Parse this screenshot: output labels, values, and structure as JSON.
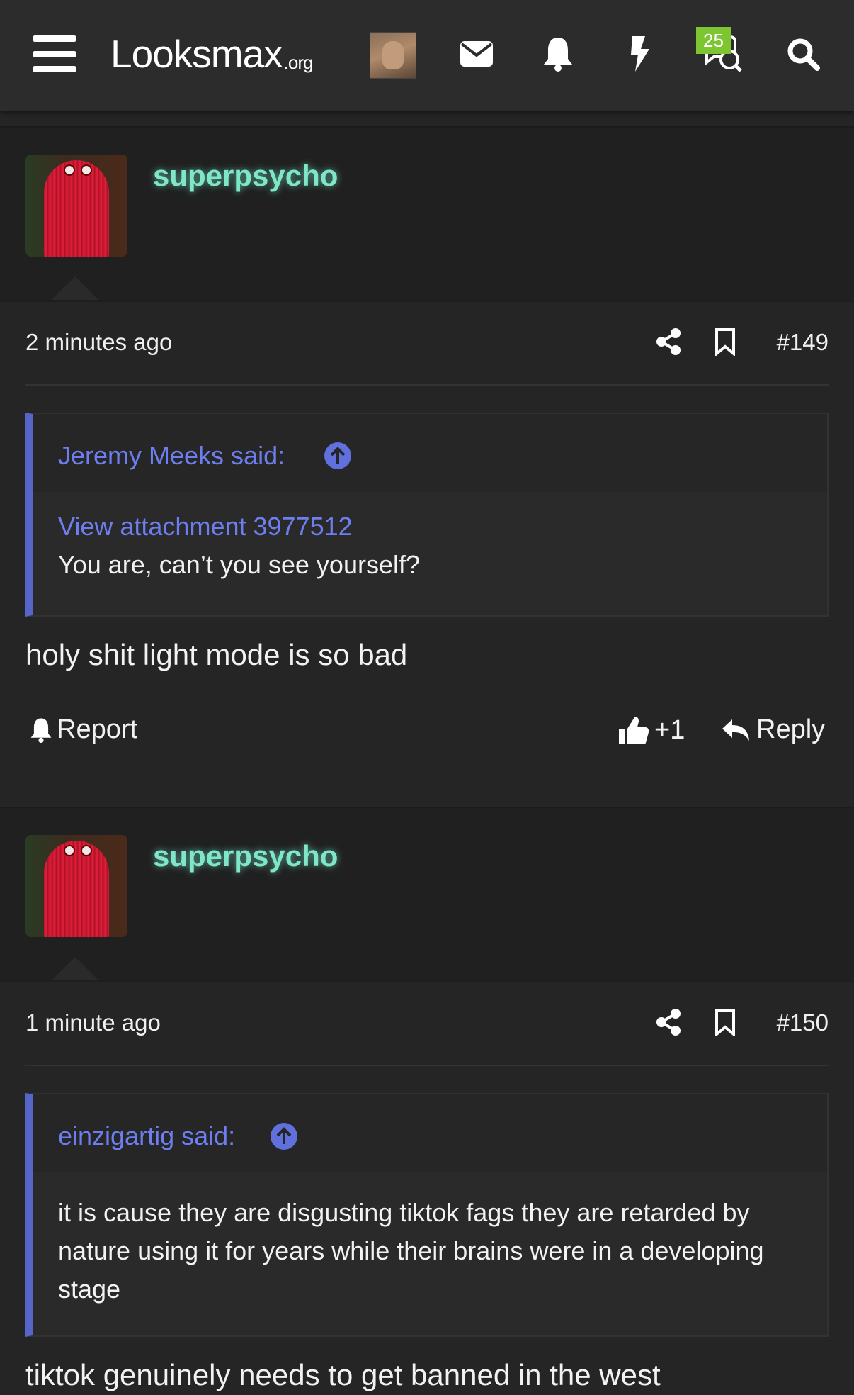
{
  "header": {
    "logo_main": "Looksmax",
    "logo_suffix": ".org",
    "badge_count": "25",
    "icons": [
      "menu-icon",
      "mail-icon",
      "bell-icon",
      "bolt-icon",
      "chat-icon",
      "search-icon"
    ]
  },
  "posts": [
    {
      "username": "superpsycho",
      "timestamp": "2 minutes ago",
      "number": "#149",
      "quote": {
        "author": "Jeremy Meeks said:",
        "attachment": "View attachment 3977512",
        "text": "You are, can’t you see yourself?"
      },
      "body": "holy shit light mode is so bad",
      "actions": {
        "report": "Report",
        "like": "+1",
        "reply": "Reply"
      }
    },
    {
      "username": "superpsycho",
      "timestamp": "1 minute ago",
      "number": "#150",
      "quote": {
        "author": "einzigartig said:",
        "text": "it is cause they are disgusting tiktok fags they are retarded by nature using it for years while their brains were in a developing stage"
      },
      "body": "tiktok genuinely needs to get banned in the west"
    }
  ],
  "colors": {
    "background": "#252525",
    "username": "#7fe6c8",
    "quote_accent": "#5565c8",
    "link": "#6d7ff0",
    "badge": "#7ec532"
  }
}
